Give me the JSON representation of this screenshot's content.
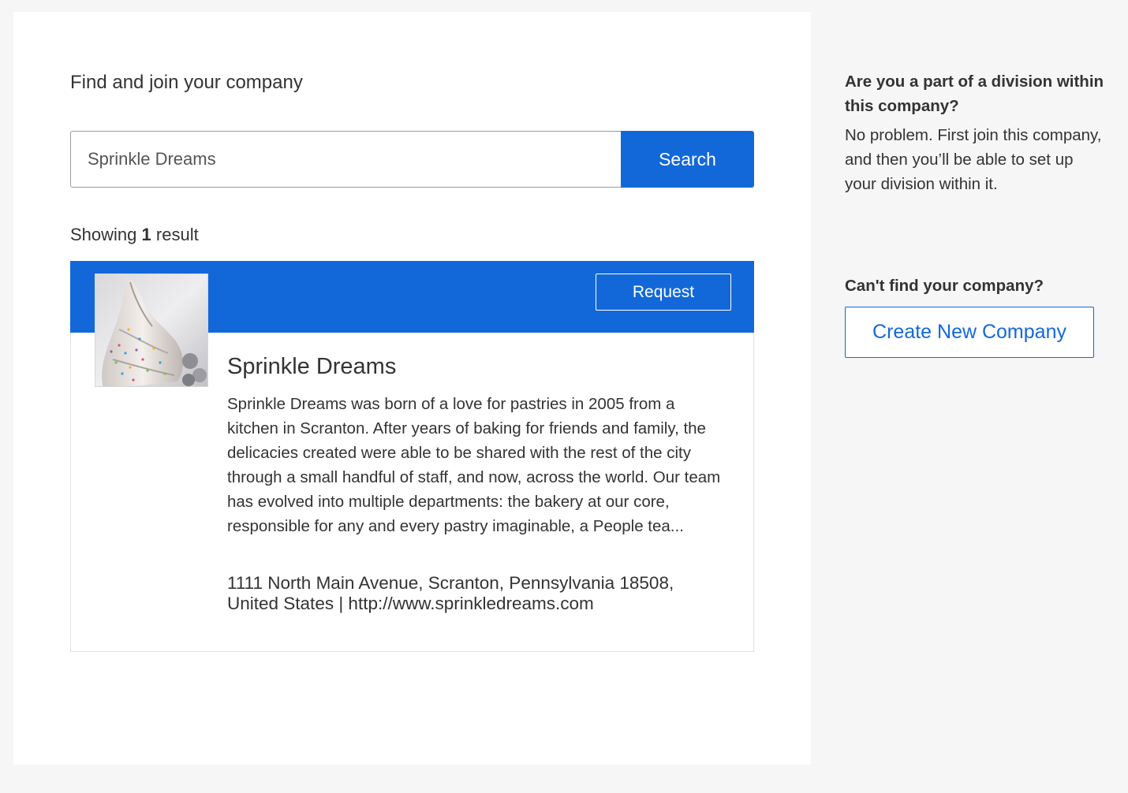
{
  "main": {
    "title": "Find and join your company",
    "search": {
      "value": "Sprinkle Dreams",
      "button_label": "Search"
    },
    "results": {
      "prefix": "Showing",
      "count": "1",
      "suffix": "result"
    },
    "company": {
      "request_label": "Request",
      "name": "Sprinkle Dreams",
      "description": "Sprinkle Dreams was born of a love for pastries in 2005 from a kitchen in Scranton. After years of baking for friends and family, the delicacies created were able to be shared with the rest of the city through a small handful of staff, and now, across the world. Our team has evolved into multiple departments: the bakery at our core, responsible for any and every pastry imaginable, a People tea...",
      "address": "1111 North Main Avenue, Scranton, Pennsylvania 18508, United States | http://www.sprinkledreams.com",
      "logo": "meringue-photo"
    }
  },
  "sidebar": {
    "division_heading": "Are you a part of a division within this company?",
    "division_text": "No problem. First join this company, and then you’ll be able to set up your division within it.",
    "cant_find_heading": "Can't find your company?",
    "create_button_label": "Create New Company"
  },
  "colors": {
    "accent": "#1368d9",
    "page_background": "#f6f6f6",
    "panel_background": "#ffffff",
    "text": "#333333"
  }
}
